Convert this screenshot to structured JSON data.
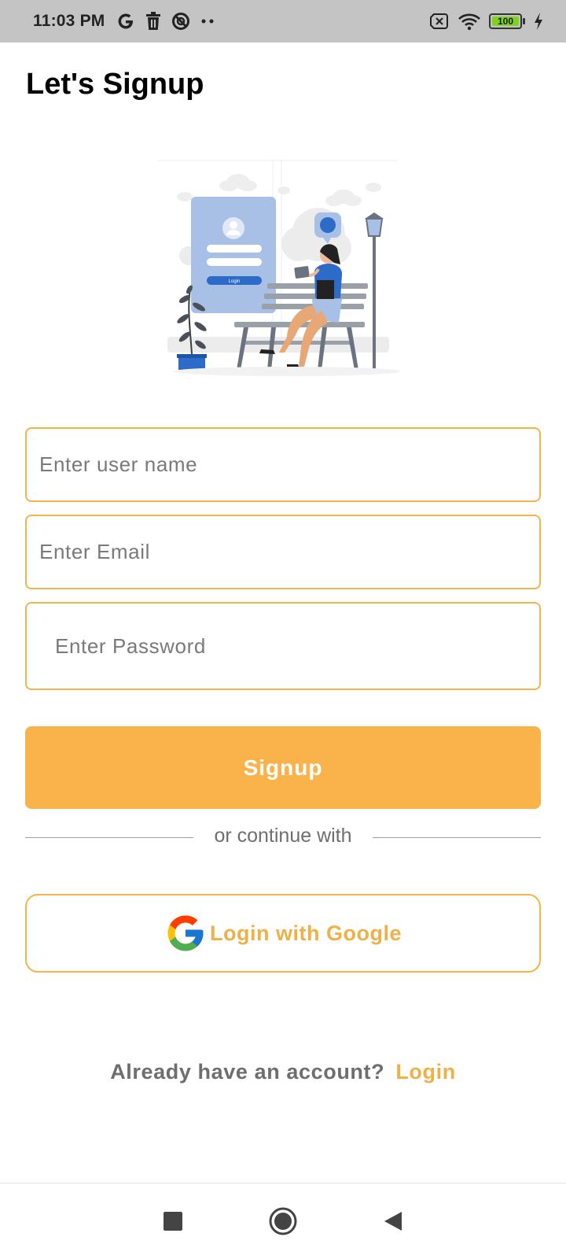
{
  "status_bar": {
    "time": "11:03 PM",
    "left_icons": [
      "google-icon",
      "delete-icon",
      "blocked-icon",
      "more-dots-icon"
    ],
    "right_icons": [
      "sim-off-icon",
      "wifi-icon",
      "battery-icon",
      "charging-icon"
    ],
    "battery_level": "100",
    "battery_color": "#7ed321"
  },
  "header": {
    "title": "Let's Signup"
  },
  "illustration": {
    "icon": "signup-illustration",
    "login_button_text": "Login"
  },
  "form": {
    "username": {
      "placeholder": "Enter user name",
      "value": ""
    },
    "email": {
      "placeholder": "Enter Email",
      "value": ""
    },
    "password": {
      "placeholder": "Enter Password",
      "value": ""
    },
    "signup_label": "Signup"
  },
  "divider": {
    "text": "or continue with"
  },
  "google": {
    "label": "Login with Google",
    "icon": "google-logo-icon"
  },
  "footer": {
    "prompt": "Already have an account?",
    "login_label": "Login"
  },
  "nav_bar": {
    "icons": [
      "recents-square-icon",
      "home-circle-icon",
      "back-triangle-icon"
    ]
  },
  "colors": {
    "accent": "#fab34a",
    "accent_text": "#f0b048",
    "border": "#f2b54a",
    "status_bar_bg": "#c4c4c4",
    "illustration_blue": "#2d6bc8"
  }
}
